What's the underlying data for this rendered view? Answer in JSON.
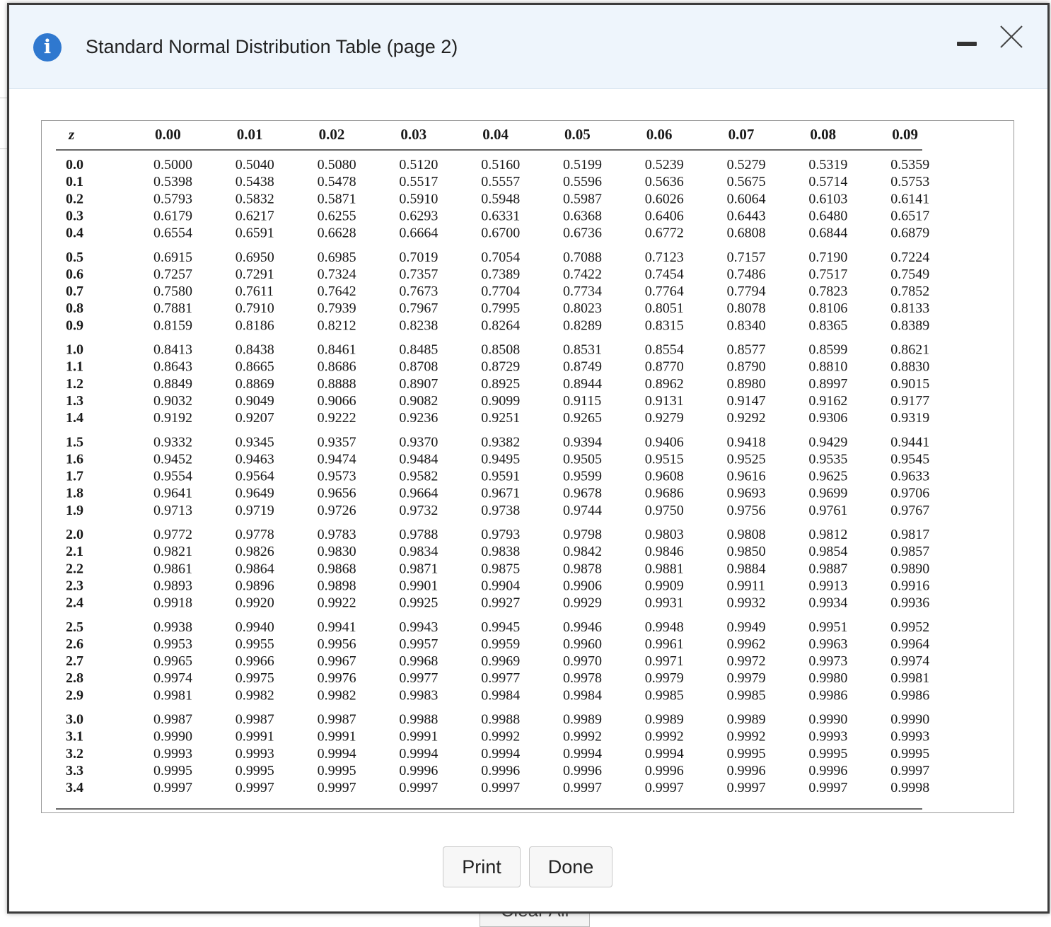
{
  "window": {
    "title": "Standard Normal Distribution Table (page 2)"
  },
  "buttons": {
    "print": "Print",
    "done": "Done"
  },
  "background": {
    "clear_all": "Clear All"
  },
  "colors": {
    "header_bg": "#eef5fc",
    "info_icon": "#2f78cf",
    "link": "#2a6fd1"
  },
  "table": {
    "z_header": "z",
    "columns": [
      "0.00",
      "0.01",
      "0.02",
      "0.03",
      "0.04",
      "0.05",
      "0.06",
      "0.07",
      "0.08",
      "0.09"
    ],
    "rows": [
      {
        "z": "0.0",
        "v": [
          "0.5000",
          "0.5040",
          "0.5080",
          "0.5120",
          "0.5160",
          "0.5199",
          "0.5239",
          "0.5279",
          "0.5319",
          "0.5359"
        ]
      },
      {
        "z": "0.1",
        "v": [
          "0.5398",
          "0.5438",
          "0.5478",
          "0.5517",
          "0.5557",
          "0.5596",
          "0.5636",
          "0.5675",
          "0.5714",
          "0.5753"
        ]
      },
      {
        "z": "0.2",
        "v": [
          "0.5793",
          "0.5832",
          "0.5871",
          "0.5910",
          "0.5948",
          "0.5987",
          "0.6026",
          "0.6064",
          "0.6103",
          "0.6141"
        ]
      },
      {
        "z": "0.3",
        "v": [
          "0.6179",
          "0.6217",
          "0.6255",
          "0.6293",
          "0.6331",
          "0.6368",
          "0.6406",
          "0.6443",
          "0.6480",
          "0.6517"
        ]
      },
      {
        "z": "0.4",
        "v": [
          "0.6554",
          "0.6591",
          "0.6628",
          "0.6664",
          "0.6700",
          "0.6736",
          "0.6772",
          "0.6808",
          "0.6844",
          "0.6879"
        ]
      },
      {
        "z": "0.5",
        "v": [
          "0.6915",
          "0.6950",
          "0.6985",
          "0.7019",
          "0.7054",
          "0.7088",
          "0.7123",
          "0.7157",
          "0.7190",
          "0.7224"
        ]
      },
      {
        "z": "0.6",
        "v": [
          "0.7257",
          "0.7291",
          "0.7324",
          "0.7357",
          "0.7389",
          "0.7422",
          "0.7454",
          "0.7486",
          "0.7517",
          "0.7549"
        ]
      },
      {
        "z": "0.7",
        "v": [
          "0.7580",
          "0.7611",
          "0.7642",
          "0.7673",
          "0.7704",
          "0.7734",
          "0.7764",
          "0.7794",
          "0.7823",
          "0.7852"
        ]
      },
      {
        "z": "0.8",
        "v": [
          "0.7881",
          "0.7910",
          "0.7939",
          "0.7967",
          "0.7995",
          "0.8023",
          "0.8051",
          "0.8078",
          "0.8106",
          "0.8133"
        ]
      },
      {
        "z": "0.9",
        "v": [
          "0.8159",
          "0.8186",
          "0.8212",
          "0.8238",
          "0.8264",
          "0.8289",
          "0.8315",
          "0.8340",
          "0.8365",
          "0.8389"
        ]
      },
      {
        "z": "1.0",
        "v": [
          "0.8413",
          "0.8438",
          "0.8461",
          "0.8485",
          "0.8508",
          "0.8531",
          "0.8554",
          "0.8577",
          "0.8599",
          "0.8621"
        ]
      },
      {
        "z": "1.1",
        "v": [
          "0.8643",
          "0.8665",
          "0.8686",
          "0.8708",
          "0.8729",
          "0.8749",
          "0.8770",
          "0.8790",
          "0.8810",
          "0.8830"
        ]
      },
      {
        "z": "1.2",
        "v": [
          "0.8849",
          "0.8869",
          "0.8888",
          "0.8907",
          "0.8925",
          "0.8944",
          "0.8962",
          "0.8980",
          "0.8997",
          "0.9015"
        ]
      },
      {
        "z": "1.3",
        "v": [
          "0.9032",
          "0.9049",
          "0.9066",
          "0.9082",
          "0.9099",
          "0.9115",
          "0.9131",
          "0.9147",
          "0.9162",
          "0.9177"
        ]
      },
      {
        "z": "1.4",
        "v": [
          "0.9192",
          "0.9207",
          "0.9222",
          "0.9236",
          "0.9251",
          "0.9265",
          "0.9279",
          "0.9292",
          "0.9306",
          "0.9319"
        ]
      },
      {
        "z": "1.5",
        "v": [
          "0.9332",
          "0.9345",
          "0.9357",
          "0.9370",
          "0.9382",
          "0.9394",
          "0.9406",
          "0.9418",
          "0.9429",
          "0.9441"
        ]
      },
      {
        "z": "1.6",
        "v": [
          "0.9452",
          "0.9463",
          "0.9474",
          "0.9484",
          "0.9495",
          "0.9505",
          "0.9515",
          "0.9525",
          "0.9535",
          "0.9545"
        ]
      },
      {
        "z": "1.7",
        "v": [
          "0.9554",
          "0.9564",
          "0.9573",
          "0.9582",
          "0.9591",
          "0.9599",
          "0.9608",
          "0.9616",
          "0.9625",
          "0.9633"
        ]
      },
      {
        "z": "1.8",
        "v": [
          "0.9641",
          "0.9649",
          "0.9656",
          "0.9664",
          "0.9671",
          "0.9678",
          "0.9686",
          "0.9693",
          "0.9699",
          "0.9706"
        ]
      },
      {
        "z": "1.9",
        "v": [
          "0.9713",
          "0.9719",
          "0.9726",
          "0.9732",
          "0.9738",
          "0.9744",
          "0.9750",
          "0.9756",
          "0.9761",
          "0.9767"
        ]
      },
      {
        "z": "2.0",
        "v": [
          "0.9772",
          "0.9778",
          "0.9783",
          "0.9788",
          "0.9793",
          "0.9798",
          "0.9803",
          "0.9808",
          "0.9812",
          "0.9817"
        ]
      },
      {
        "z": "2.1",
        "v": [
          "0.9821",
          "0.9826",
          "0.9830",
          "0.9834",
          "0.9838",
          "0.9842",
          "0.9846",
          "0.9850",
          "0.9854",
          "0.9857"
        ]
      },
      {
        "z": "2.2",
        "v": [
          "0.9861",
          "0.9864",
          "0.9868",
          "0.9871",
          "0.9875",
          "0.9878",
          "0.9881",
          "0.9884",
          "0.9887",
          "0.9890"
        ]
      },
      {
        "z": "2.3",
        "v": [
          "0.9893",
          "0.9896",
          "0.9898",
          "0.9901",
          "0.9904",
          "0.9906",
          "0.9909",
          "0.9911",
          "0.9913",
          "0.9916"
        ]
      },
      {
        "z": "2.4",
        "v": [
          "0.9918",
          "0.9920",
          "0.9922",
          "0.9925",
          "0.9927",
          "0.9929",
          "0.9931",
          "0.9932",
          "0.9934",
          "0.9936"
        ]
      },
      {
        "z": "2.5",
        "v": [
          "0.9938",
          "0.9940",
          "0.9941",
          "0.9943",
          "0.9945",
          "0.9946",
          "0.9948",
          "0.9949",
          "0.9951",
          "0.9952"
        ]
      },
      {
        "z": "2.6",
        "v": [
          "0.9953",
          "0.9955",
          "0.9956",
          "0.9957",
          "0.9959",
          "0.9960",
          "0.9961",
          "0.9962",
          "0.9963",
          "0.9964"
        ]
      },
      {
        "z": "2.7",
        "v": [
          "0.9965",
          "0.9966",
          "0.9967",
          "0.9968",
          "0.9969",
          "0.9970",
          "0.9971",
          "0.9972",
          "0.9973",
          "0.9974"
        ]
      },
      {
        "z": "2.8",
        "v": [
          "0.9974",
          "0.9975",
          "0.9976",
          "0.9977",
          "0.9977",
          "0.9978",
          "0.9979",
          "0.9979",
          "0.9980",
          "0.9981"
        ]
      },
      {
        "z": "2.9",
        "v": [
          "0.9981",
          "0.9982",
          "0.9982",
          "0.9983",
          "0.9984",
          "0.9984",
          "0.9985",
          "0.9985",
          "0.9986",
          "0.9986"
        ]
      },
      {
        "z": "3.0",
        "v": [
          "0.9987",
          "0.9987",
          "0.9987",
          "0.9988",
          "0.9988",
          "0.9989",
          "0.9989",
          "0.9989",
          "0.9990",
          "0.9990"
        ]
      },
      {
        "z": "3.1",
        "v": [
          "0.9990",
          "0.9991",
          "0.9991",
          "0.9991",
          "0.9992",
          "0.9992",
          "0.9992",
          "0.9992",
          "0.9993",
          "0.9993"
        ]
      },
      {
        "z": "3.2",
        "v": [
          "0.9993",
          "0.9993",
          "0.9994",
          "0.9994",
          "0.9994",
          "0.9994",
          "0.9994",
          "0.9995",
          "0.9995",
          "0.9995"
        ]
      },
      {
        "z": "3.3",
        "v": [
          "0.9995",
          "0.9995",
          "0.9995",
          "0.9996",
          "0.9996",
          "0.9996",
          "0.9996",
          "0.9996",
          "0.9996",
          "0.9997"
        ]
      },
      {
        "z": "3.4",
        "v": [
          "0.9997",
          "0.9997",
          "0.9997",
          "0.9997",
          "0.9997",
          "0.9997",
          "0.9997",
          "0.9997",
          "0.9997",
          "0.9998"
        ]
      }
    ]
  }
}
